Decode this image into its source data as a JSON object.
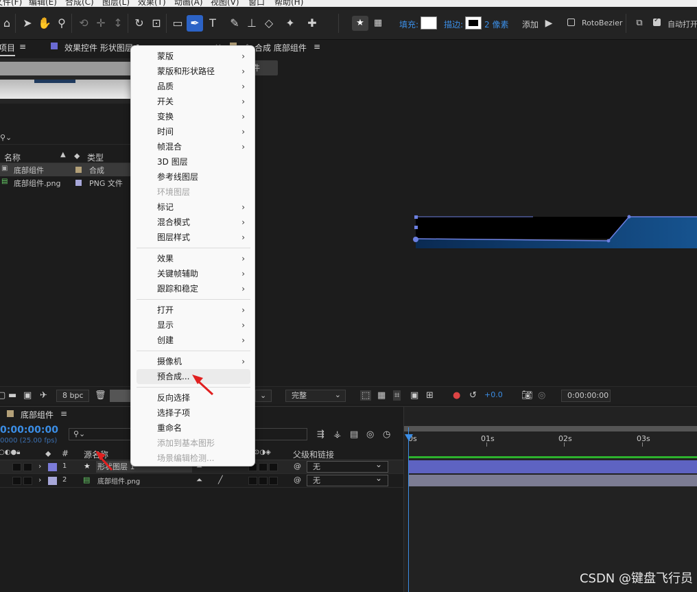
{
  "menubar": [
    "文件(F)",
    "编辑(E)",
    "合成(C)",
    "图层(L)",
    "效果(T)",
    "动画(A)",
    "视图(V)",
    "窗口",
    "帮助(H)"
  ],
  "toolbar": {
    "fill_label": "填充:",
    "stroke_label": "描边:",
    "stroke_width": "2 像素",
    "add_label": "添加",
    "rotobezier_label": "RotoBezier",
    "auto_open_label": "自动打开",
    "accent_color": "#2c63c6"
  },
  "project_panel": {
    "tab_label": "项目",
    "effects_tab_label": "效果控件 形状图层 1",
    "search_placeholder": "",
    "col_name": "名称",
    "col_type": "类型",
    "items": [
      {
        "name": "底部组件",
        "type": "合成",
        "color": "#b3a078"
      },
      {
        "name": "底部组件.png",
        "type": "PNG 文件",
        "color": "#a7a7d9"
      }
    ]
  },
  "comp_panel": {
    "tab_label": "合成 底部组件",
    "btn_label": "件",
    "bpc_label": "8 bpc",
    "quality": "完整",
    "exposure": "+0.0",
    "timecode": "0:00:00:00"
  },
  "context_menu": {
    "items": [
      {
        "label": "蒙版",
        "submenu": true,
        "disabled": false
      },
      {
        "label": "蒙版和形状路径",
        "submenu": true,
        "disabled": false
      },
      {
        "label": "品质",
        "submenu": true,
        "disabled": false
      },
      {
        "label": "开关",
        "submenu": true,
        "disabled": false
      },
      {
        "label": "变换",
        "submenu": true,
        "disabled": false
      },
      {
        "label": "时间",
        "submenu": true,
        "disabled": false
      },
      {
        "label": "帧混合",
        "submenu": true,
        "disabled": false
      },
      {
        "label": "3D 图层",
        "submenu": false,
        "disabled": false
      },
      {
        "label": "参考线图层",
        "submenu": false,
        "disabled": false
      },
      {
        "label": "环境图层",
        "submenu": false,
        "disabled": true
      },
      {
        "label": "标记",
        "submenu": true,
        "disabled": false
      },
      {
        "label": "混合模式",
        "submenu": true,
        "disabled": false
      },
      {
        "label": "图层样式",
        "submenu": true,
        "disabled": false
      },
      {
        "label": "效果",
        "submenu": true,
        "disabled": false
      },
      {
        "label": "关键帧辅助",
        "submenu": true,
        "disabled": false
      },
      {
        "label": "跟踪和稳定",
        "submenu": true,
        "disabled": false
      },
      {
        "label": "打开",
        "submenu": true,
        "disabled": false
      },
      {
        "label": "显示",
        "submenu": true,
        "disabled": false
      },
      {
        "label": "创建",
        "submenu": true,
        "disabled": false
      },
      {
        "label": "摄像机",
        "submenu": true,
        "disabled": false
      },
      {
        "label": "预合成...",
        "submenu": false,
        "disabled": false,
        "hover": true
      },
      {
        "label": "反向选择",
        "submenu": false,
        "disabled": false
      },
      {
        "label": "选择子项",
        "submenu": false,
        "disabled": false
      },
      {
        "label": "重命名",
        "submenu": false,
        "disabled": false
      },
      {
        "label": "添加到基本图形",
        "submenu": false,
        "disabled": true
      },
      {
        "label": "场景编辑检测...",
        "submenu": false,
        "disabled": true
      }
    ]
  },
  "timeline": {
    "tab_label": "底部组件",
    "timecode": "0:00:00:00",
    "fps_label": "0000 (25.00 fps)",
    "col_source": "源名称",
    "col_parent": "父级和链接",
    "ruler": [
      "0s",
      "01s",
      "02s",
      "03s"
    ],
    "layers": [
      {
        "num": "1",
        "name": "形状图层 1",
        "parent": "无",
        "color": "#7b7bd9"
      },
      {
        "num": "2",
        "name": "底部组件.png",
        "parent": "无",
        "color": "#a7a7d9"
      }
    ]
  },
  "watermark": "CSDN @键盘飞行员"
}
